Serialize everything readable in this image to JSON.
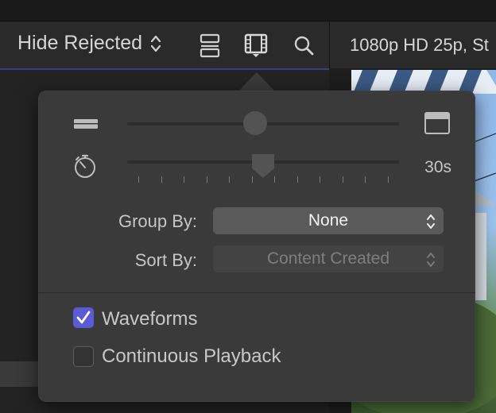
{
  "toolbar": {
    "filter_label": "Hide Rejected",
    "preset_label": "1080p HD 25p, St"
  },
  "popover": {
    "duration_value": "30s",
    "group_by": {
      "label": "Group By:",
      "value": "None"
    },
    "sort_by": {
      "label": "Sort By:",
      "value": "Content Created"
    },
    "waveforms": {
      "label": "Waveforms",
      "checked": true
    },
    "continuous_playback": {
      "label": "Continuous Playback",
      "checked": false
    },
    "clip_height_level": 0.47,
    "duration_level": 0.5
  },
  "colors": {
    "accent": "#5b5bd6"
  }
}
